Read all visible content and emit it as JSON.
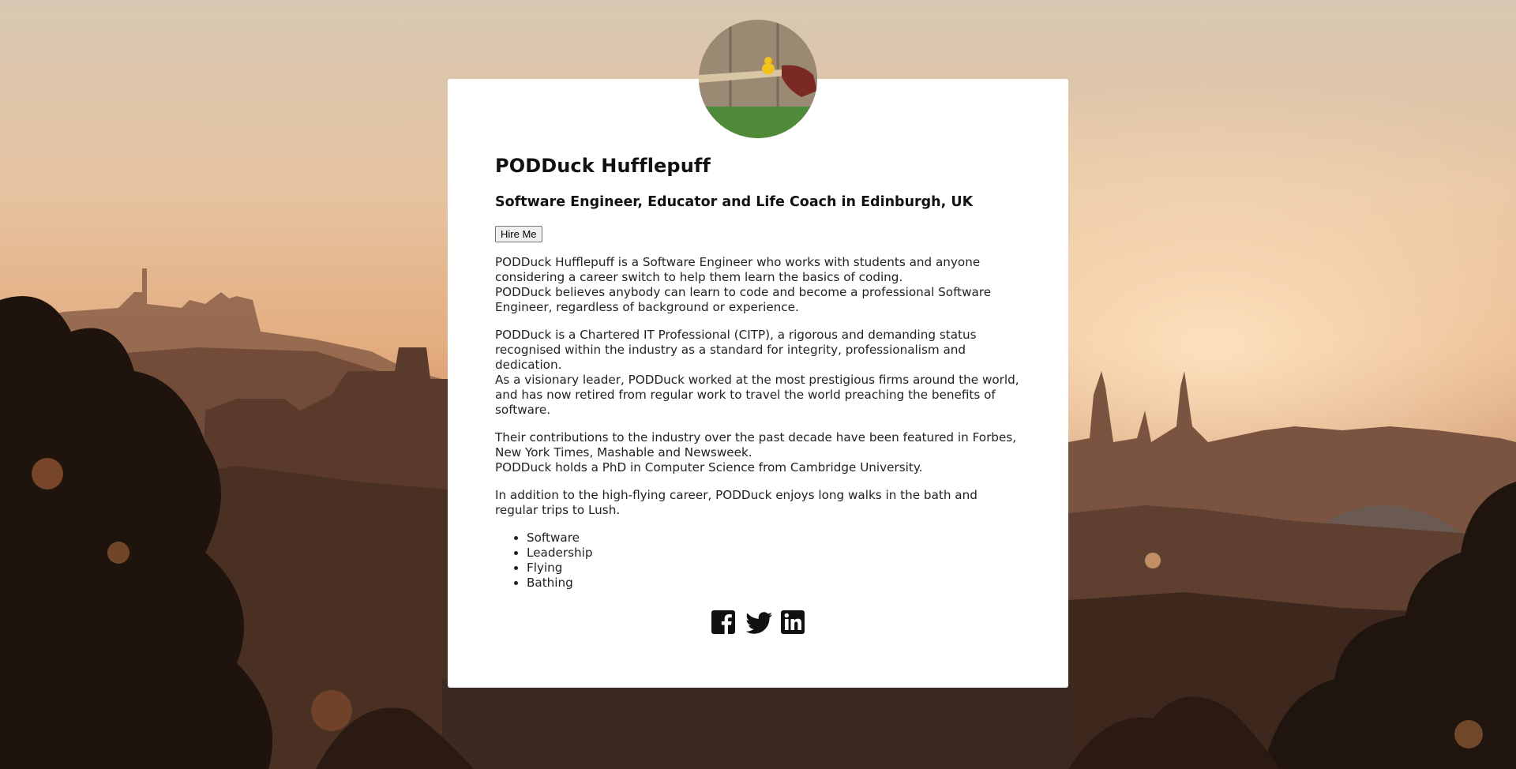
{
  "profile": {
    "name": "PODDuck Hufflepuff",
    "tagline": "Software Engineer, Educator and Life Coach in Edinburgh, UK",
    "hire_label": "Hire Me",
    "avatar_icon": "duck-avatar-icon"
  },
  "bio": [
    {
      "lines": [
        "PODDuck Hufflepuff is a Software Engineer who works with students and anyone considering a career switch to help them learn the basics of coding.",
        "PODDuck believes anybody can learn to code and become a professional Software Engineer, regardless of background or experience."
      ]
    },
    {
      "lines": [
        "PODDuck is a Chartered IT Professional (CITP), a rigorous and demanding status recognised within the industry as a standard for integrity, professionalism and dedication.",
        "As a visionary leader, PODDuck worked at the most prestigious firms around the world, and has now retired from regular work to travel the world preaching the benefits of software."
      ]
    },
    {
      "lines": [
        "Their contributions to the industry over the past decade have been featured in Forbes, New York Times, Mashable and Newsweek.",
        "PODDuck holds a PhD in Computer Science from Cambridge University."
      ]
    },
    {
      "lines": [
        "In addition to the high-flying career, PODDuck enjoys long walks in the bath and regular trips to Lush."
      ]
    }
  ],
  "skills": [
    "Software",
    "Leadership",
    "Flying",
    "Bathing"
  ],
  "social": {
    "facebook_icon": "facebook-icon",
    "twitter_icon": "twitter-icon",
    "linkedin_icon": "linkedin-icon"
  },
  "colors": {
    "card_bg": "#ffffff",
    "text": "#111111",
    "sky_top": "#d9c7ae",
    "sky_mid": "#e8b98e"
  }
}
